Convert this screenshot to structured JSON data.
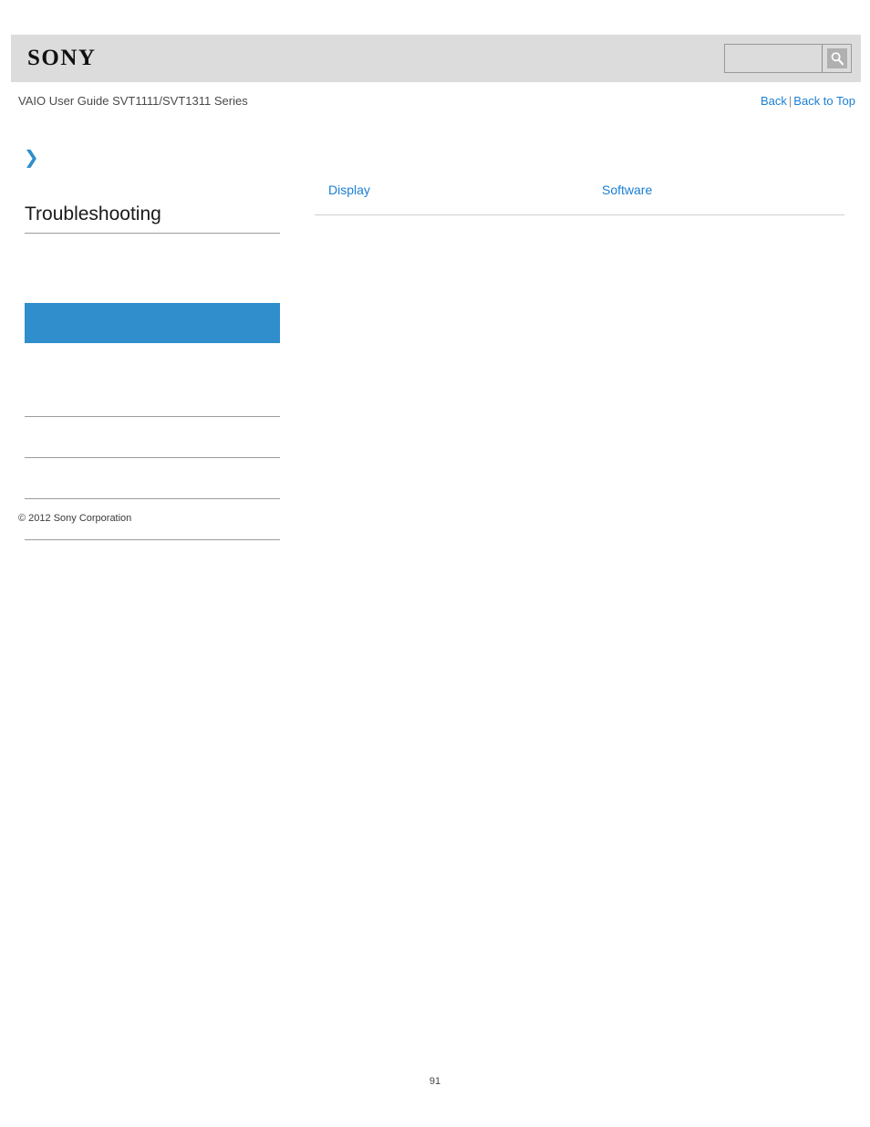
{
  "header": {
    "logo_text": "SONY",
    "logo_icon": "sony-wordmark"
  },
  "search": {
    "value": "",
    "placeholder": "",
    "button_icon": "search-icon",
    "button_label": "Search"
  },
  "subheader": {
    "title": "VAIO User Guide SVT1111/SVT1311 Series",
    "links": [
      {
        "label": "Back"
      },
      {
        "label": "Back to Top"
      }
    ],
    "separator": "|"
  },
  "sidebar": {
    "expand_icon": "double-chevron-right-icon",
    "section_title": "Troubleshooting",
    "items": [
      {
        "label": "",
        "selected": false,
        "spacer": true
      },
      {
        "label": "",
        "selected": true
      },
      {
        "label": "",
        "selected": false,
        "spacer": true
      },
      {
        "label": "",
        "selected": false
      },
      {
        "label": "",
        "selected": false
      },
      {
        "label": "",
        "selected": false
      },
      {
        "label": "",
        "selected": false
      }
    ],
    "copyright": "© 2012 Sony Corporation"
  },
  "main": {
    "topics": [
      {
        "col_1": "Display",
        "col_2": "Software"
      }
    ]
  },
  "footer": {
    "page_number": "91"
  },
  "colors": {
    "header_background": "#dcdcdc",
    "accent_blue": "#2f8ecb",
    "link_blue": "#1a7fd4",
    "rule_gray": "#9b9b9b",
    "main_rule_gray": "#cfcfcf"
  }
}
